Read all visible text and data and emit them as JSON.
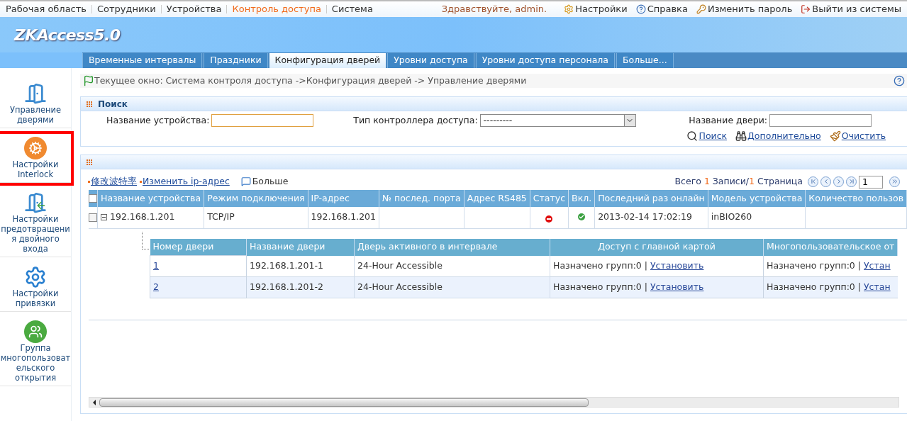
{
  "top_menu": [
    {
      "label": "Рабочая область",
      "selected": false
    },
    {
      "label": "Сотрудники",
      "selected": false
    },
    {
      "label": "Устройства",
      "selected": false
    },
    {
      "label": "Контроль доступа",
      "selected": true
    },
    {
      "label": "Система",
      "selected": false
    }
  ],
  "greeting": "Здравствуйте, admin.",
  "user_links": [
    {
      "kind": "settings",
      "label": "Настройки"
    },
    {
      "kind": "help",
      "label": "Справка"
    },
    {
      "kind": "password",
      "label": "Изменить пароль"
    },
    {
      "kind": "logout",
      "label": "Выйти из системы"
    }
  ],
  "logo": "ZKAccess5.0",
  "tabs": [
    {
      "label": "Временные интервалы",
      "selected": false
    },
    {
      "label": "Праздники",
      "selected": false
    },
    {
      "label": "Конфигурация дверей",
      "selected": true
    },
    {
      "label": "Уровни доступа",
      "selected": false
    },
    {
      "label": "Уровни доступа персонала",
      "selected": false
    },
    {
      "label": "Больше...",
      "selected": false
    }
  ],
  "breadcrumb": "Текущее окно: Система контроля доступа ->Конфигурация дверей -> Управление дверями",
  "sidebar": {
    "items": [
      {
        "kind": "door",
        "label": "Управление дверями",
        "highlighted": false
      },
      {
        "kind": "interlock",
        "label": "Настройки Interlock",
        "highlighted": true
      },
      {
        "kind": "antipassback",
        "label": "Настройки предотвращения двойного входа",
        "highlighted": false
      },
      {
        "kind": "linkage",
        "label": "Настройки привязки",
        "highlighted": false
      },
      {
        "kind": "group",
        "label": "Группа многопользовательского открытия",
        "highlighted": false
      }
    ]
  },
  "search": {
    "title": "Поиск",
    "device_name": {
      "label": "Название устройства:"
    },
    "controller_type": {
      "label": "Тип контроллера доступа:",
      "value": "---------"
    },
    "door_name": {
      "label": "Название двери:"
    },
    "actions": [
      {
        "kind": "search",
        "label": "Поиск"
      },
      {
        "kind": "advanced",
        "label": "Дополнительно"
      },
      {
        "kind": "clear",
        "label": "Очистить"
      }
    ]
  },
  "grid": {
    "toolbar": [
      {
        "kind": "link",
        "label": "修改波特率"
      },
      {
        "kind": "link",
        "label": "Изменить ip-адрес"
      },
      {
        "kind": "more",
        "label": "Больше"
      }
    ],
    "summary": {
      "prefix": "Всего",
      "records": "1",
      "records_label": "Записи/",
      "pages": "1",
      "pages_label": "Страница"
    },
    "page": "1",
    "all_checked": false,
    "columns": [
      "Название устройства",
      "Режим подключения",
      "IP-адрес",
      "№ послед. порта",
      "Адрес RS485",
      "Статус",
      "Вкл.",
      "Последний раз онлайн",
      "Модель устройства",
      "Количество пользов"
    ],
    "rows": [
      {
        "checked": false,
        "expanded": true,
        "device": "192.168.1.201",
        "mode": "TCP/IP",
        "ip": "192.168.1.201",
        "port": "",
        "rs485": "",
        "online": false,
        "enabled": true,
        "last_online": "2013-02-14 17:02:19",
        "model": "inBIO260",
        "users": ""
      }
    ],
    "doors": {
      "columns": [
        "Номер двери",
        "Название двери",
        "Дверь активного в интервале",
        "Доступ с главной картой",
        "Многопользовательское от"
      ],
      "rows": [
        {
          "number": "1",
          "name": "192.168.1.201-1",
          "interval": "24-Hour Accessible",
          "master": "Назначено групп:0 |",
          "master_link": "Установить",
          "multi": "Назначено групп:0 |",
          "multi_link": "Устан"
        },
        {
          "number": "2",
          "name": "192.168.1.201-2",
          "interval": "24-Hour Accessible",
          "master": "Назначено групп:0 |",
          "master_link": "Установить",
          "multi": "Назначено групп:0 |",
          "multi_link": "Устан"
        }
      ]
    }
  }
}
